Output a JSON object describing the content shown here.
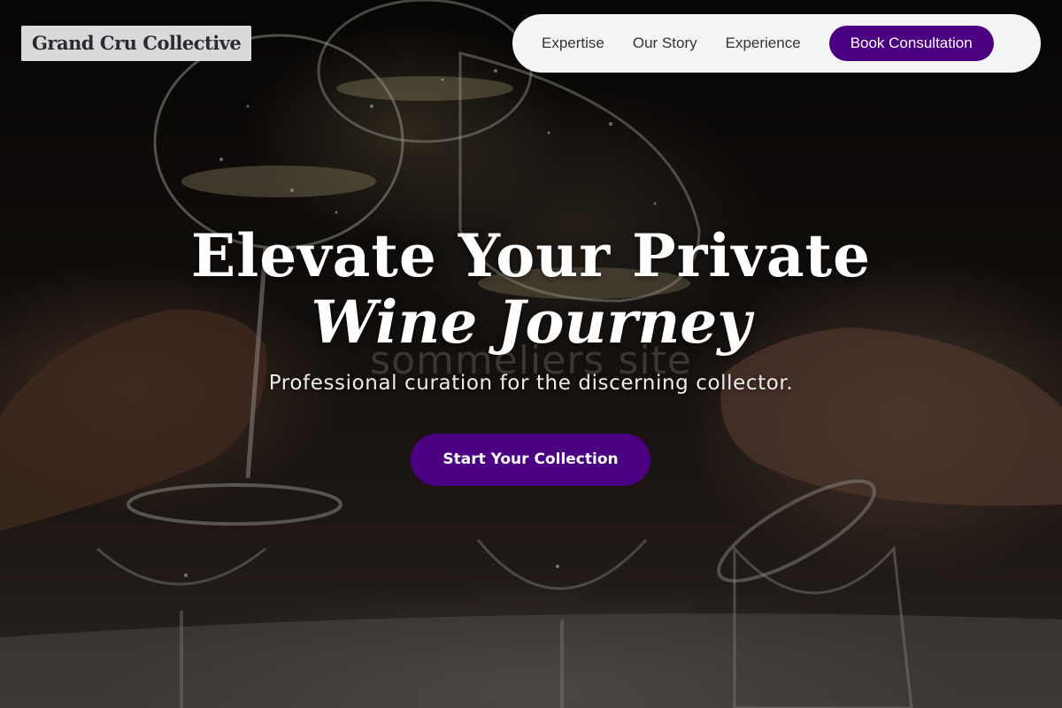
{
  "brand": {
    "name": "Grand Cru Collective"
  },
  "nav": {
    "links": [
      "Expertise",
      "Our Story",
      "Experience"
    ],
    "cta_label": "Book Consultation"
  },
  "hero": {
    "title_line1": "Elevate Your Private",
    "title_line2": "Wine Journey",
    "ghost_text": "sommeliers site",
    "subtitle": "Professional curation for the discerning collector.",
    "cta_label": "Start Your Collection"
  },
  "colors": {
    "accent": "#4b0082",
    "nav_background": "#f5f5f5",
    "logo_background": "#d9d9d9"
  }
}
